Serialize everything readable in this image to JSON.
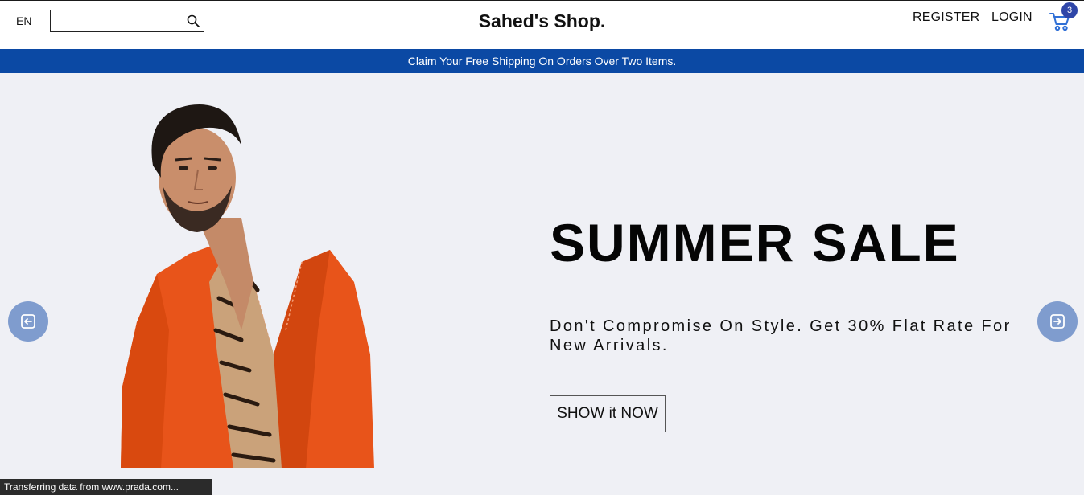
{
  "navbar": {
    "language": "EN",
    "search": {
      "value": "",
      "placeholder": ""
    },
    "logo": "Sahed's Shop.",
    "register": "REGISTER",
    "login": "LOGIN",
    "cart_count": "3"
  },
  "announcement": "Claim Your Free Shipping On Orders Over Two Items.",
  "hero": {
    "title": "SUMMER SALE",
    "description": "Don't Compromise On Style. Get 30% Flat Rate For New Arrivals.",
    "cta": "SHOW it NOW"
  },
  "status_bar": "Transferring data from www.prada.com...",
  "icons": {
    "search": "search-icon",
    "cart": "shopping-cart-icon",
    "prev": "arrow-left-icon",
    "next": "arrow-right-icon"
  },
  "colors": {
    "announcement_bg": "#0b49a4",
    "hero_bg": "#eff0f5",
    "arrow_bg": "#7f9cce",
    "cart_badge": "#2f46a8",
    "jacket": "#e8541a"
  }
}
